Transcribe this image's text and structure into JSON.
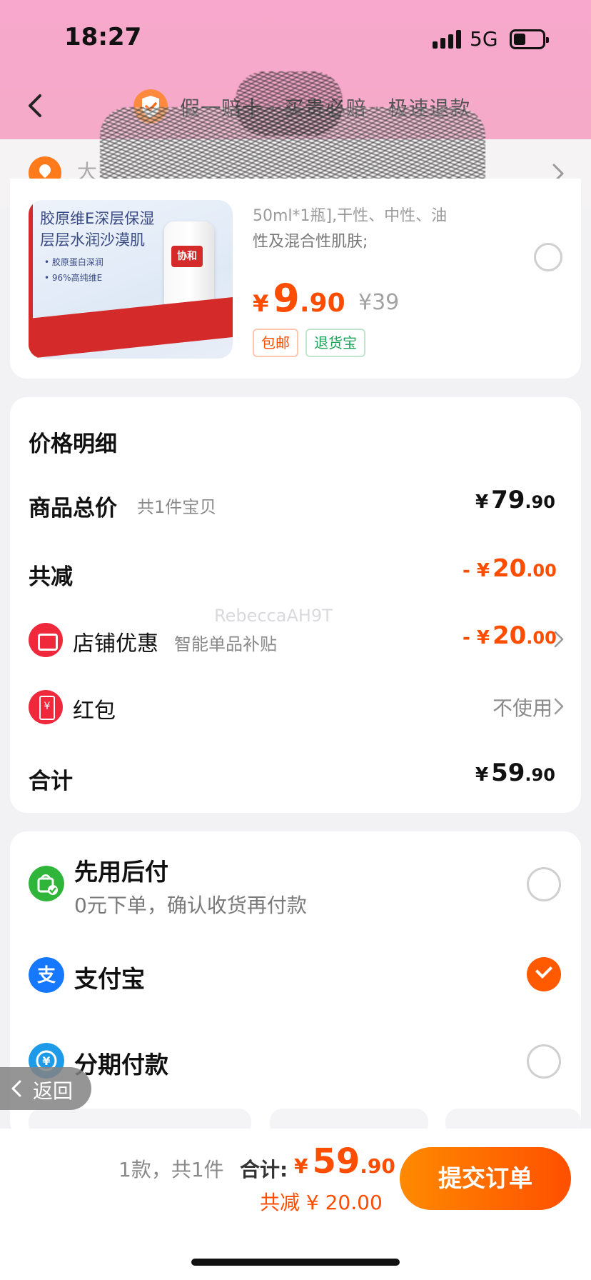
{
  "status_bar": {
    "time": "18:27",
    "network": "5G"
  },
  "header": {
    "guarantee_text": "假一赔十 · 买贵必赔 · 极速退款"
  },
  "address": {
    "partial_text": "大"
  },
  "product": {
    "image_headline_1": "胶原维E深层保湿",
    "image_headline_2": "层层水润沙漠肌",
    "image_bullet_1": "• 胶原蛋白深润",
    "image_bullet_2": "• 96%高纯维E",
    "bottle_brand": "协和",
    "desc_line_1": "50ml*1瓶],干性、中性、油",
    "desc_line_2": "性及混合性肌肤;",
    "price_currency": "¥",
    "price_int": "9",
    "price_dec": ".90",
    "original_price": "¥39",
    "tag_shipping": "包邮",
    "tag_return": "退货宝"
  },
  "price_detail": {
    "title": "价格明细",
    "subtotal_label": "商品总价",
    "subtotal_sub": "共1件宝贝",
    "subtotal_currency": "¥",
    "subtotal_int": "79",
    "subtotal_dec": ".90",
    "discount_label": "共减",
    "discount_prefix": "- ¥",
    "discount_int": "20",
    "discount_dec": ".00",
    "shop_promo_label": "店铺优惠",
    "shop_promo_sub": "智能单品补贴",
    "shop_promo_prefix": "- ¥",
    "shop_promo_int": "20",
    "shop_promo_dec": ".00",
    "red_packet_label": "红包",
    "red_packet_value": "不使用",
    "total_label": "合计",
    "total_currency": "¥",
    "total_int": "59",
    "total_dec": ".90"
  },
  "watermark": "RebeccaAH9T",
  "payment": {
    "option_1_title": "先用后付",
    "option_1_sub": "0元下单，确认收货再付款",
    "option_2_title": "支付宝",
    "option_3_title": "分期付款",
    "selected": "支付宝"
  },
  "back_pill": {
    "label": "返回"
  },
  "bottom_bar": {
    "count_text": "1款，共1件",
    "total_label": "合计:",
    "total_currency": "¥",
    "total_int": "59",
    "total_dec": ".90",
    "saved_text": "共减 ¥ 20.00",
    "submit_label": "提交订单"
  },
  "colors": {
    "accent_orange": "#ff4d00",
    "header_pink": "#f7a8cc",
    "alipay_blue": "#1677ff",
    "paylater_green": "#2fb53a",
    "shop_red": "#f0283c"
  }
}
